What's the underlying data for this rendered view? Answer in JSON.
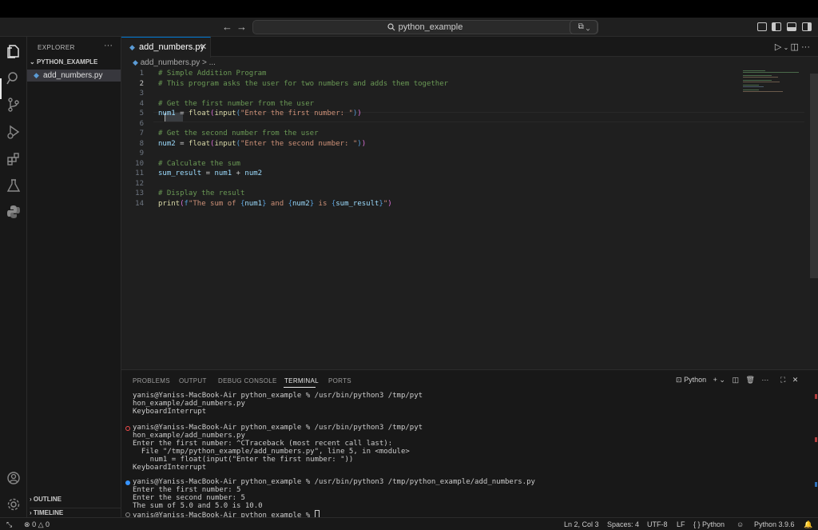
{
  "titlebar": {
    "search": "python_example"
  },
  "sidebar": {
    "title": "EXPLORER",
    "more": "···",
    "folder": "PYTHON_EXAMPLE",
    "file": "add_numbers.py",
    "outline": "OUTLINE",
    "timeline": "TIMELINE"
  },
  "editor": {
    "tab_label": "add_numbers.py",
    "tab_close": "✕",
    "breadcrumb_file": "add_numbers.py",
    "breadcrumb_rest": "> ...",
    "line_numbers": [
      "1",
      "2",
      "3",
      "4",
      "5",
      "6",
      "7",
      "8",
      "9",
      "10",
      "11",
      "12",
      "13",
      "14"
    ],
    "lines": {
      "l1": "# Simple Addition Program",
      "l2": "# This program asks the user for two numbers and adds them together",
      "l4": "# Get the first number from the user",
      "l5_var": "num1",
      "l5_op": " = ",
      "l5_fn1": "float",
      "l5_fn2": "input",
      "l5_str": "\"Enter the first number: \"",
      "l7": "# Get the second number from the user",
      "l8_var": "num2",
      "l8_op": " = ",
      "l8_fn1": "float",
      "l8_fn2": "input",
      "l8_str": "\"Enter the second number: \"",
      "l10": "# Calculate the sum",
      "l11_var": "sum_result",
      "l11_op": " = ",
      "l11_a": "num1",
      "l11_plus": " + ",
      "l11_b": "num2",
      "l13": "# Display the result",
      "l14_fn": "print",
      "l14_f": "f",
      "l14_s1": "\"The sum of ",
      "l14_v1": "num1",
      "l14_s2": " and ",
      "l14_v2": "num2",
      "l14_s3": " is ",
      "l14_v3": "sum_result",
      "l14_s4": "\""
    }
  },
  "panel": {
    "tabs": [
      "PROBLEMS",
      "OUTPUT",
      "DEBUG CONSOLE",
      "TERMINAL",
      "PORTS"
    ],
    "shell_label": "Python",
    "terminal": [
      "yanis@Yaniss-MacBook-Air python_example % /usr/bin/python3 /tmp/pyt",
      "hon_example/add_numbers.py",
      "KeyboardInterrupt",
      "yanis@Yaniss-MacBook-Air python_example % /usr/bin/python3 /tmp/pyt",
      "hon_example/add_numbers.py",
      "Enter the first number: ^CTraceback (most recent call last):",
      "  File \"/tmp/python_example/add_numbers.py\", line 5, in <module>",
      "    num1 = float(input(\"Enter the first number: \"))",
      "KeyboardInterrupt",
      "yanis@Yaniss-MacBook-Air python_example % /usr/bin/python3 /tmp/python_example/add_numbers.py",
      "Enter the first number: 5",
      "Enter the second number: 5",
      "The sum of 5.0 and 5.0 is 10.0",
      "yanis@Yaniss-MacBook-Air python_example % "
    ]
  },
  "statusbar": {
    "errors": "0",
    "warnings": "0",
    "position": "Ln 2, Col 3",
    "spaces": "Spaces: 4",
    "encoding": "UTF-8",
    "eol": "LF",
    "language": "Python",
    "interpreter": "Python 3.9.6"
  },
  "colors": {
    "accent": "#0078d4",
    "comment": "#6a9955",
    "string": "#ce9178",
    "function": "#dcdcaa",
    "variable": "#9cdcfe"
  }
}
